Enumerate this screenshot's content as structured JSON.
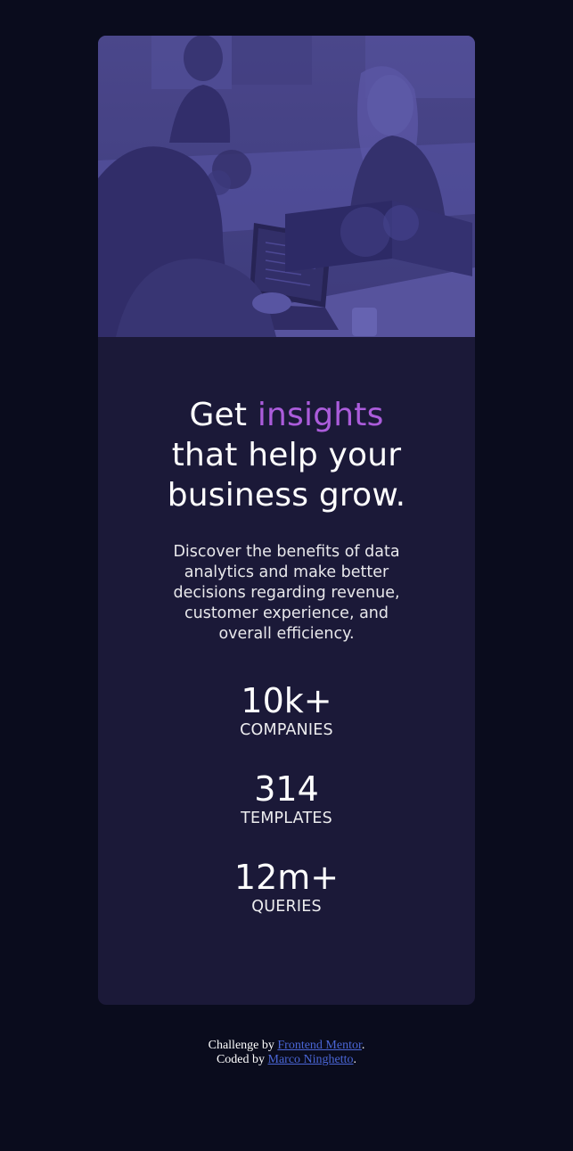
{
  "card": {
    "image_alt": "Team working at laptops",
    "headline_pre": "Get ",
    "headline_accent": "insights",
    "headline_post": " that help your business grow.",
    "description": "Discover the benefits of data analytics and make better decisions regarding revenue, customer experience, and overall efficiency."
  },
  "stats": [
    {
      "value": "10k+",
      "label": "Companies"
    },
    {
      "value": "314",
      "label": "Templates"
    },
    {
      "value": "12m+",
      "label": "Queries"
    }
  ],
  "attribution": {
    "challenge_prefix": "Challenge by ",
    "challenge_link": "Frontend Mentor",
    "challenge_suffix": ".",
    "coded_prefix": "Coded by ",
    "coded_link": "Marco Ninghetto",
    "coded_suffix": "."
  },
  "colors": {
    "background": "#0a0c1d",
    "card": "#1b1938",
    "accent": "#ab5cdb",
    "image_overlay": "#4c48a0",
    "link": "#4a66d6"
  }
}
